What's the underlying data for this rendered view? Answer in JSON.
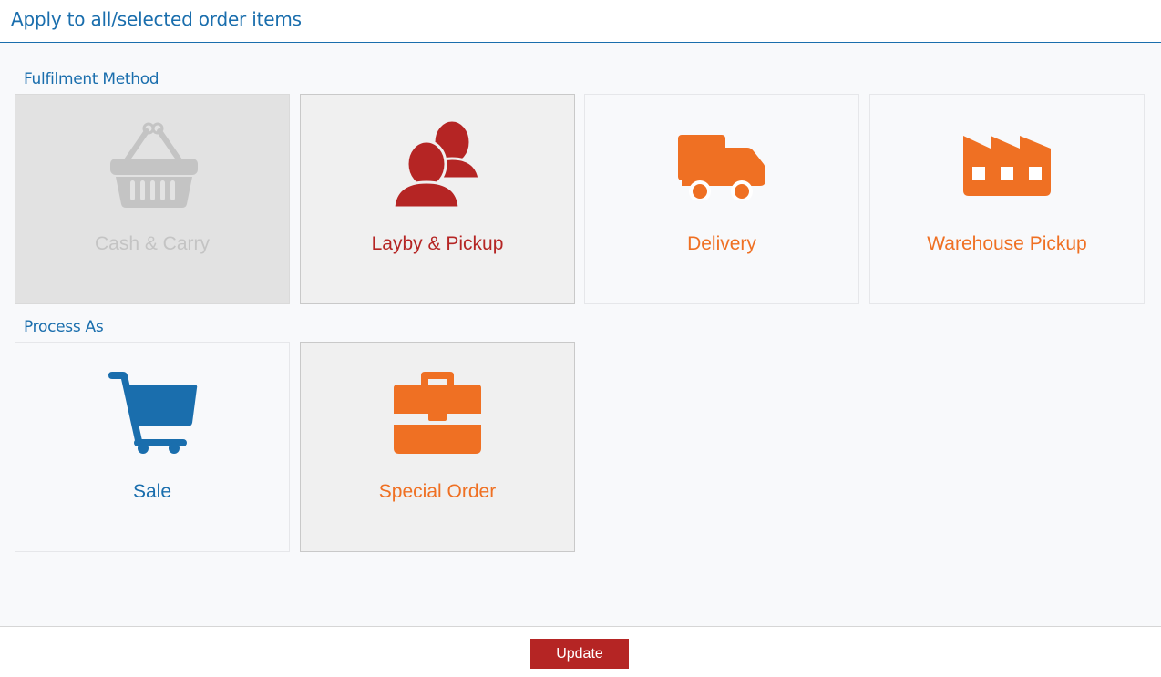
{
  "header": {
    "title": "Apply to all/selected order items"
  },
  "fulfilment": {
    "label": "Fulfilment Method",
    "options": [
      {
        "label": "Cash & Carry",
        "icon": "basket-icon",
        "state": "disabled",
        "color": "#c4c4c4"
      },
      {
        "label": "Layby & Pickup",
        "icon": "users-icon",
        "state": "hover",
        "color": "#b52524"
      },
      {
        "label": "Delivery",
        "icon": "truck-icon",
        "state": "normal",
        "color": "#ef7023"
      },
      {
        "label": "Warehouse Pickup",
        "icon": "factory-icon",
        "state": "normal",
        "color": "#ef7023"
      }
    ]
  },
  "process": {
    "label": "Process As",
    "options": [
      {
        "label": "Sale",
        "icon": "cart-icon",
        "state": "normal",
        "color": "#1a6ead"
      },
      {
        "label": "Special Order",
        "icon": "briefcase-icon",
        "state": "hover",
        "color": "#ef7023"
      }
    ]
  },
  "footer": {
    "update_label": "Update"
  },
  "colors": {
    "brand_blue": "#1a6ead",
    "accent_red": "#b52524",
    "accent_orange": "#ef7023",
    "disabled_gray": "#c4c4c4"
  }
}
